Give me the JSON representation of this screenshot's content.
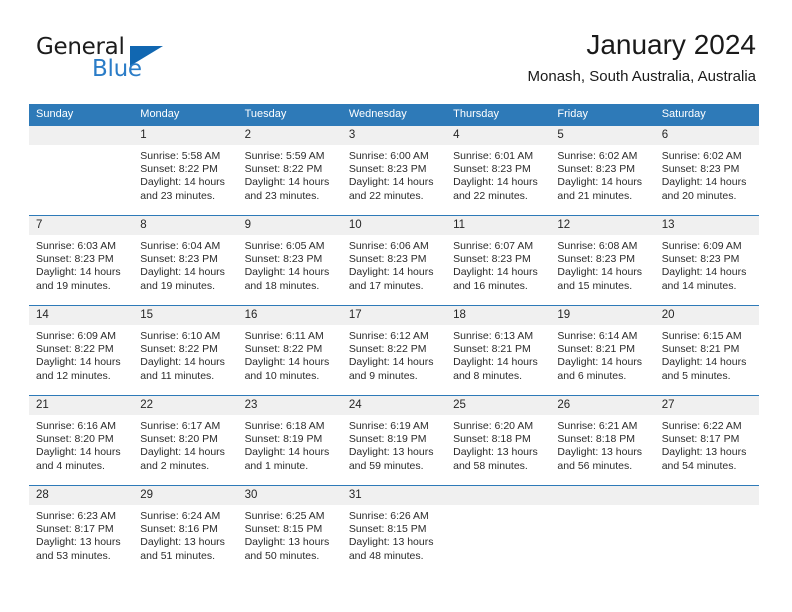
{
  "brand": {
    "name_part1": "General",
    "name_part2": "Blue",
    "triangle_icon": "triangle-logo-icon",
    "color_primary": "#1167b1",
    "color_secondary": "#2a7cc7"
  },
  "header": {
    "title": "January 2024",
    "subtitle": "Monash, South Australia, Australia"
  },
  "theme": {
    "header_row_bg": "#2e7ab8",
    "date_band_bg": "#f0f0f0",
    "cell_bg": "#ffffff",
    "text_color": "#2b2b2b"
  },
  "weekdays": [
    "Sunday",
    "Monday",
    "Tuesday",
    "Wednesday",
    "Thursday",
    "Friday",
    "Saturday"
  ],
  "weeks": [
    {
      "numbers": [
        "",
        "1",
        "2",
        "3",
        "4",
        "5",
        "6"
      ],
      "cells": [
        {
          "sunrise": "",
          "sunset": "",
          "daylight_line1": "",
          "daylight_line2": ""
        },
        {
          "sunrise": "Sunrise: 5:58 AM",
          "sunset": "Sunset: 8:22 PM",
          "daylight_line1": "Daylight: 14 hours",
          "daylight_line2": "and 23 minutes."
        },
        {
          "sunrise": "Sunrise: 5:59 AM",
          "sunset": "Sunset: 8:22 PM",
          "daylight_line1": "Daylight: 14 hours",
          "daylight_line2": "and 23 minutes."
        },
        {
          "sunrise": "Sunrise: 6:00 AM",
          "sunset": "Sunset: 8:23 PM",
          "daylight_line1": "Daylight: 14 hours",
          "daylight_line2": "and 22 minutes."
        },
        {
          "sunrise": "Sunrise: 6:01 AM",
          "sunset": "Sunset: 8:23 PM",
          "daylight_line1": "Daylight: 14 hours",
          "daylight_line2": "and 22 minutes."
        },
        {
          "sunrise": "Sunrise: 6:02 AM",
          "sunset": "Sunset: 8:23 PM",
          "daylight_line1": "Daylight: 14 hours",
          "daylight_line2": "and 21 minutes."
        },
        {
          "sunrise": "Sunrise: 6:02 AM",
          "sunset": "Sunset: 8:23 PM",
          "daylight_line1": "Daylight: 14 hours",
          "daylight_line2": "and 20 minutes."
        }
      ]
    },
    {
      "numbers": [
        "7",
        "8",
        "9",
        "10",
        "11",
        "12",
        "13"
      ],
      "cells": [
        {
          "sunrise": "Sunrise: 6:03 AM",
          "sunset": "Sunset: 8:23 PM",
          "daylight_line1": "Daylight: 14 hours",
          "daylight_line2": "and 19 minutes."
        },
        {
          "sunrise": "Sunrise: 6:04 AM",
          "sunset": "Sunset: 8:23 PM",
          "daylight_line1": "Daylight: 14 hours",
          "daylight_line2": "and 19 minutes."
        },
        {
          "sunrise": "Sunrise: 6:05 AM",
          "sunset": "Sunset: 8:23 PM",
          "daylight_line1": "Daylight: 14 hours",
          "daylight_line2": "and 18 minutes."
        },
        {
          "sunrise": "Sunrise: 6:06 AM",
          "sunset": "Sunset: 8:23 PM",
          "daylight_line1": "Daylight: 14 hours",
          "daylight_line2": "and 17 minutes."
        },
        {
          "sunrise": "Sunrise: 6:07 AM",
          "sunset": "Sunset: 8:23 PM",
          "daylight_line1": "Daylight: 14 hours",
          "daylight_line2": "and 16 minutes."
        },
        {
          "sunrise": "Sunrise: 6:08 AM",
          "sunset": "Sunset: 8:23 PM",
          "daylight_line1": "Daylight: 14 hours",
          "daylight_line2": "and 15 minutes."
        },
        {
          "sunrise": "Sunrise: 6:09 AM",
          "sunset": "Sunset: 8:23 PM",
          "daylight_line1": "Daylight: 14 hours",
          "daylight_line2": "and 14 minutes."
        }
      ]
    },
    {
      "numbers": [
        "14",
        "15",
        "16",
        "17",
        "18",
        "19",
        "20"
      ],
      "cells": [
        {
          "sunrise": "Sunrise: 6:09 AM",
          "sunset": "Sunset: 8:22 PM",
          "daylight_line1": "Daylight: 14 hours",
          "daylight_line2": "and 12 minutes."
        },
        {
          "sunrise": "Sunrise: 6:10 AM",
          "sunset": "Sunset: 8:22 PM",
          "daylight_line1": "Daylight: 14 hours",
          "daylight_line2": "and 11 minutes."
        },
        {
          "sunrise": "Sunrise: 6:11 AM",
          "sunset": "Sunset: 8:22 PM",
          "daylight_line1": "Daylight: 14 hours",
          "daylight_line2": "and 10 minutes."
        },
        {
          "sunrise": "Sunrise: 6:12 AM",
          "sunset": "Sunset: 8:22 PM",
          "daylight_line1": "Daylight: 14 hours",
          "daylight_line2": "and 9 minutes."
        },
        {
          "sunrise": "Sunrise: 6:13 AM",
          "sunset": "Sunset: 8:21 PM",
          "daylight_line1": "Daylight: 14 hours",
          "daylight_line2": "and 8 minutes."
        },
        {
          "sunrise": "Sunrise: 6:14 AM",
          "sunset": "Sunset: 8:21 PM",
          "daylight_line1": "Daylight: 14 hours",
          "daylight_line2": "and 6 minutes."
        },
        {
          "sunrise": "Sunrise: 6:15 AM",
          "sunset": "Sunset: 8:21 PM",
          "daylight_line1": "Daylight: 14 hours",
          "daylight_line2": "and 5 minutes."
        }
      ]
    },
    {
      "numbers": [
        "21",
        "22",
        "23",
        "24",
        "25",
        "26",
        "27"
      ],
      "cells": [
        {
          "sunrise": "Sunrise: 6:16 AM",
          "sunset": "Sunset: 8:20 PM",
          "daylight_line1": "Daylight: 14 hours",
          "daylight_line2": "and 4 minutes."
        },
        {
          "sunrise": "Sunrise: 6:17 AM",
          "sunset": "Sunset: 8:20 PM",
          "daylight_line1": "Daylight: 14 hours",
          "daylight_line2": "and 2 minutes."
        },
        {
          "sunrise": "Sunrise: 6:18 AM",
          "sunset": "Sunset: 8:19 PM",
          "daylight_line1": "Daylight: 14 hours",
          "daylight_line2": "and 1 minute."
        },
        {
          "sunrise": "Sunrise: 6:19 AM",
          "sunset": "Sunset: 8:19 PM",
          "daylight_line1": "Daylight: 13 hours",
          "daylight_line2": "and 59 minutes."
        },
        {
          "sunrise": "Sunrise: 6:20 AM",
          "sunset": "Sunset: 8:18 PM",
          "daylight_line1": "Daylight: 13 hours",
          "daylight_line2": "and 58 minutes."
        },
        {
          "sunrise": "Sunrise: 6:21 AM",
          "sunset": "Sunset: 8:18 PM",
          "daylight_line1": "Daylight: 13 hours",
          "daylight_line2": "and 56 minutes."
        },
        {
          "sunrise": "Sunrise: 6:22 AM",
          "sunset": "Sunset: 8:17 PM",
          "daylight_line1": "Daylight: 13 hours",
          "daylight_line2": "and 54 minutes."
        }
      ]
    },
    {
      "numbers": [
        "28",
        "29",
        "30",
        "31",
        "",
        "",
        ""
      ],
      "cells": [
        {
          "sunrise": "Sunrise: 6:23 AM",
          "sunset": "Sunset: 8:17 PM",
          "daylight_line1": "Daylight: 13 hours",
          "daylight_line2": "and 53 minutes."
        },
        {
          "sunrise": "Sunrise: 6:24 AM",
          "sunset": "Sunset: 8:16 PM",
          "daylight_line1": "Daylight: 13 hours",
          "daylight_line2": "and 51 minutes."
        },
        {
          "sunrise": "Sunrise: 6:25 AM",
          "sunset": "Sunset: 8:15 PM",
          "daylight_line1": "Daylight: 13 hours",
          "daylight_line2": "and 50 minutes."
        },
        {
          "sunrise": "Sunrise: 6:26 AM",
          "sunset": "Sunset: 8:15 PM",
          "daylight_line1": "Daylight: 13 hours",
          "daylight_line2": "and 48 minutes."
        },
        {
          "sunrise": "",
          "sunset": "",
          "daylight_line1": "",
          "daylight_line2": ""
        },
        {
          "sunrise": "",
          "sunset": "",
          "daylight_line1": "",
          "daylight_line2": ""
        },
        {
          "sunrise": "",
          "sunset": "",
          "daylight_line1": "",
          "daylight_line2": ""
        }
      ]
    }
  ]
}
